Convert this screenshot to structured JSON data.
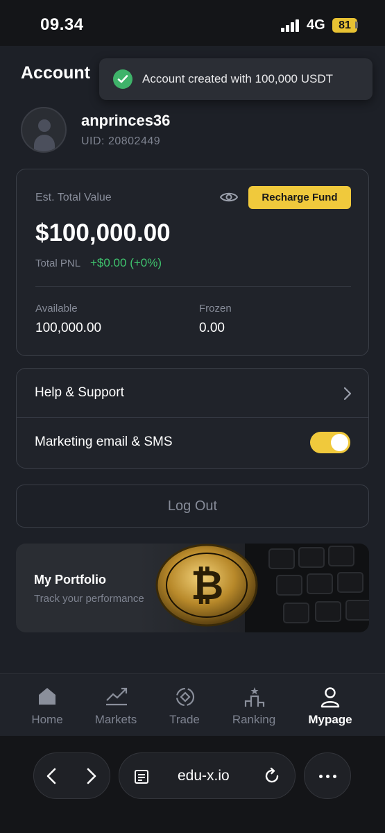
{
  "status_bar": {
    "time": "09.34",
    "network": "4G",
    "battery": "81"
  },
  "page": {
    "title": "Account"
  },
  "toast": {
    "message": "Account created with 100,000 USDT"
  },
  "profile": {
    "username": "anprinces36",
    "uid": "UID: 20802449"
  },
  "balance_card": {
    "est_label": "Est. Total Value",
    "recharge_label": "Recharge Fund",
    "total_value": "$100,000.00",
    "pnl_label": "Total PNL",
    "pnl_value": "+$0.00 (+0%)",
    "available_label": "Available",
    "available_value": "100,000.00",
    "frozen_label": "Frozen",
    "frozen_value": "0.00"
  },
  "menu": {
    "help_label": "Help & Support",
    "marketing_label": "Marketing email & SMS",
    "marketing_enabled": true
  },
  "logout_label": "Log Out",
  "portfolio": {
    "title": "My Portfolio",
    "subtitle": "Track your performance"
  },
  "bottom_nav": {
    "items": [
      {
        "label": "Home",
        "icon": "home-icon"
      },
      {
        "label": "Markets",
        "icon": "chart-trend-icon"
      },
      {
        "label": "Trade",
        "icon": "trade-exchange-icon"
      },
      {
        "label": "Ranking",
        "icon": "podium-icon"
      },
      {
        "label": "Mypage",
        "icon": "user-icon",
        "active": true
      }
    ]
  },
  "browser": {
    "url": "edu-x.io"
  },
  "colors": {
    "accent": "#f0c93c",
    "positive": "#3fc46e",
    "background": "#1d2027"
  }
}
